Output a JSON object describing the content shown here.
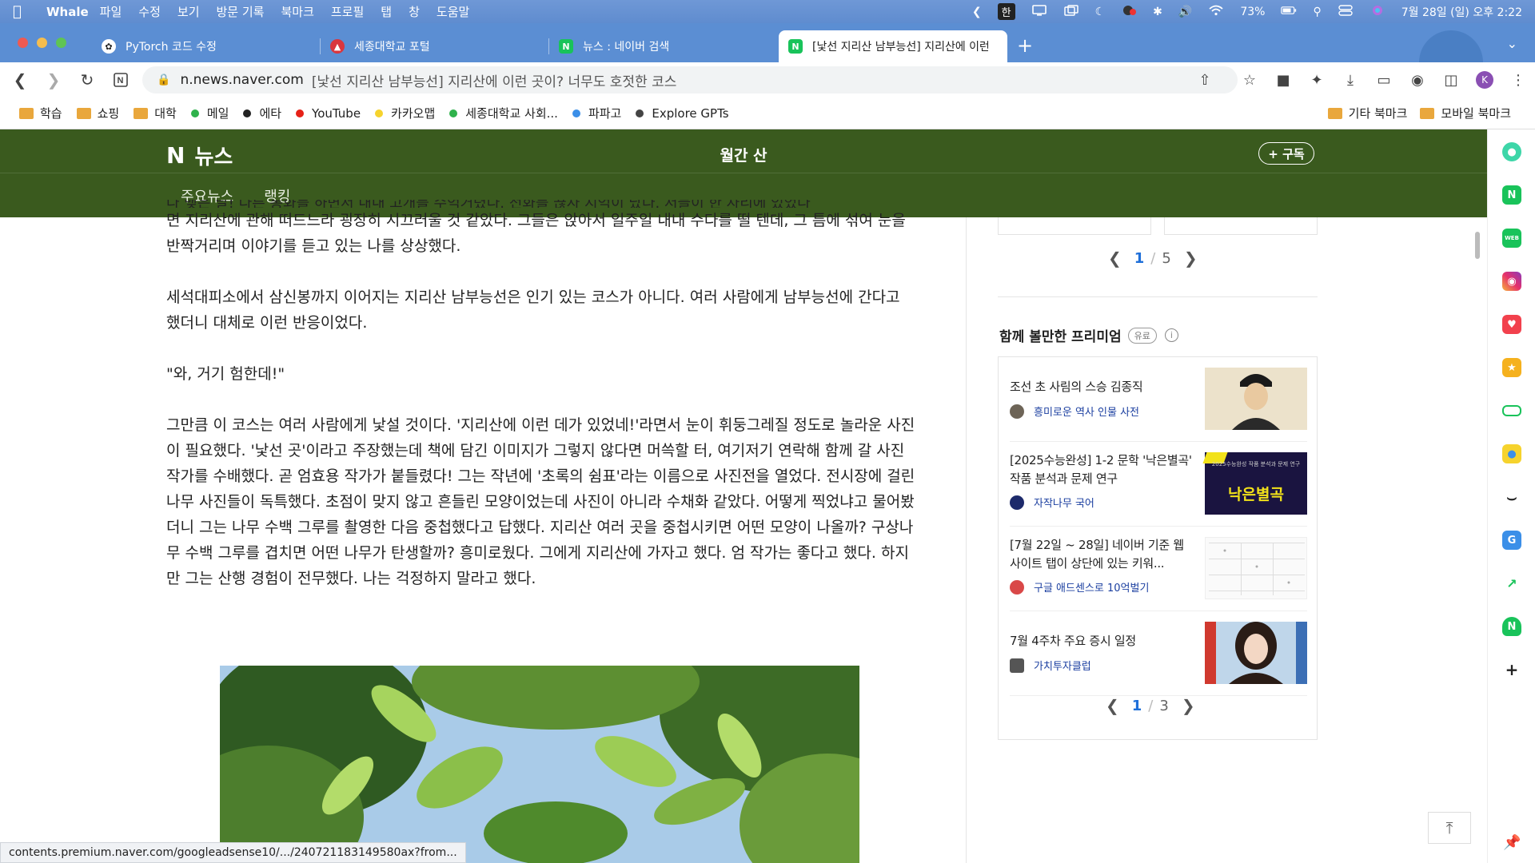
{
  "menubar": {
    "app_name": "Whale",
    "items": [
      "파일",
      "수정",
      "보기",
      "방문 기록",
      "북마크",
      "프로필",
      "탭",
      "창",
      "도움말"
    ],
    "input_mode": "한",
    "battery": "73%",
    "datetime": "7월 28일 (일) 오후 2:22"
  },
  "tabs": [
    {
      "label": "PyTorch 코드 수정",
      "icon": "openai-icon"
    },
    {
      "label": "세종대학교 포털",
      "icon": "sejong-icon"
    },
    {
      "label": "뉴스 : 네이버 검색",
      "icon": "naver-icon"
    },
    {
      "label": "[낯선 지리산 남부능선] 지리산에 이런",
      "icon": "naver-icon",
      "active": true
    }
  ],
  "address": {
    "host": "n.news.naver.com",
    "title": "[낯선 지리산 남부능선] 지리산에 이런 곳이? 너무도 호젓한 코스"
  },
  "profile_initial": "K",
  "bookmarks": [
    {
      "label": "학습",
      "type": "folder"
    },
    {
      "label": "쇼핑",
      "type": "folder"
    },
    {
      "label": "대학",
      "type": "folder"
    },
    {
      "label": "메일",
      "type": "dot",
      "color": "#2fb24c"
    },
    {
      "label": "에타",
      "type": "dot",
      "color": "#222222"
    },
    {
      "label": "YouTube",
      "type": "dot",
      "color": "#e62117"
    },
    {
      "label": "카카오맵",
      "type": "dot",
      "color": "#f6d32d"
    },
    {
      "label": "세종대학교 사회...",
      "type": "dot",
      "color": "#2fb24c"
    },
    {
      "label": "파파고",
      "type": "dot",
      "color": "#3b8fe8"
    },
    {
      "label": "Explore GPTs",
      "type": "dot",
      "color": "#444444"
    }
  ],
  "bookmarks_right": [
    "기타 북마크",
    "모바일 북마크"
  ],
  "naver": {
    "logo": "N",
    "section": "뉴스",
    "publication": "월간 산",
    "subscribe": "+ 구독",
    "nav": [
      "주요뉴스",
      "랭킹"
    ]
  },
  "article": {
    "partial_line": "다 맺은 날! 다른 통화를 하면서 내내 고개를 수억거렸다. 전화를 끊자 지억이 났다. 저들이 한 자리에 있었다",
    "paragraphs": [
      "면 지리산에 관해 떠드느라 굉장히 시끄러울 것 같았다. 그들은 앉아서 일주일 내내 수다를 떨 텐데, 그 틈에 섞여 눈을 반짝거리며 이야기를 듣고 있는 나를 상상했다.",
      "세석대피소에서 삼신봉까지 이어지는 지리산 남부능선은 인기 있는 코스가 아니다. 여러 사람에게 남부능선에 간다고 했더니 대체로 이런 반응이었다.",
      "\"와, 거기 험한데!\"",
      "그만큼 이 코스는 여러 사람에게 낯설 것이다. '지리산에 이런 데가 있었네!'라면서 눈이 휘둥그레질 정도로 놀라운 사진이 필요했다. '낯선 곳'이라고 주장했는데 책에 담긴 이미지가 그렇지 않다면 머쓱할 터, 여기저기 연락해 함께 갈 사진작가를 수배했다. 곧 엄효용 작가가 붙들렸다! 그는 작년에 '초록의 쉼표'라는 이름으로 사진전을 열었다. 전시장에 걸린 나무 사진들이 독특했다. 초점이 맞지 않고 흔들린 모양이었는데 사진이 아니라 수채화 같았다. 어떻게 찍었냐고 물어봤더니 그는 나무 수백 그루를 촬영한 다음 중첩했다고 답했다. 지리산 여러 곳을 중첩시키면 어떤 모양이 나올까? 구상나무 수백 그루를 겹치면 어떤 나무가 탄생할까? 흥미로웠다. 그에게 지리산에 가자고 했다. 엄 작가는 좋다고 했다. 하지만 그는 산행 경험이 전무했다. 나는 걱정하지 말라고 했다."
    ]
  },
  "right": {
    "top_pager": {
      "current": "1",
      "sep": "/",
      "total": "5"
    },
    "premium_title": "함께 볼만한 프리미엄",
    "paid_badge": "유료",
    "info": "i",
    "items": [
      {
        "title": "조선 초 사림의 스승 김종직",
        "source": "흥미로운 역사 인물 사전"
      },
      {
        "title": "[2025수능완성] 1-2 문학 '낙은별곡' 작품 분석과 문제 연구",
        "source": "자작나무 국어",
        "thumb_title": "낙은별곡",
        "thumb_small": "2025수능완성 작품 분석과 문제 연구"
      },
      {
        "title": "[7월 22일 ~ 28일] 네이버 기준 웹사이트 탭이 상단에 있는 키워...",
        "source": "구글 애드센스로 10억벌기"
      },
      {
        "title": "7월 4주차 주요 증시 일정",
        "source": "가치투자클럽"
      }
    ],
    "bottom_pager": {
      "current": "1",
      "sep": "/",
      "total": "3"
    }
  },
  "status_url": "contents.premium.naver.com/googleadsense10/.../240721183149580ax?from...",
  "colors": {
    "naver_header": "#3a5a1e",
    "tabstrip": "#5b8ed3",
    "link": "#1b3fa0",
    "pager_current": "#1e6fd9"
  }
}
